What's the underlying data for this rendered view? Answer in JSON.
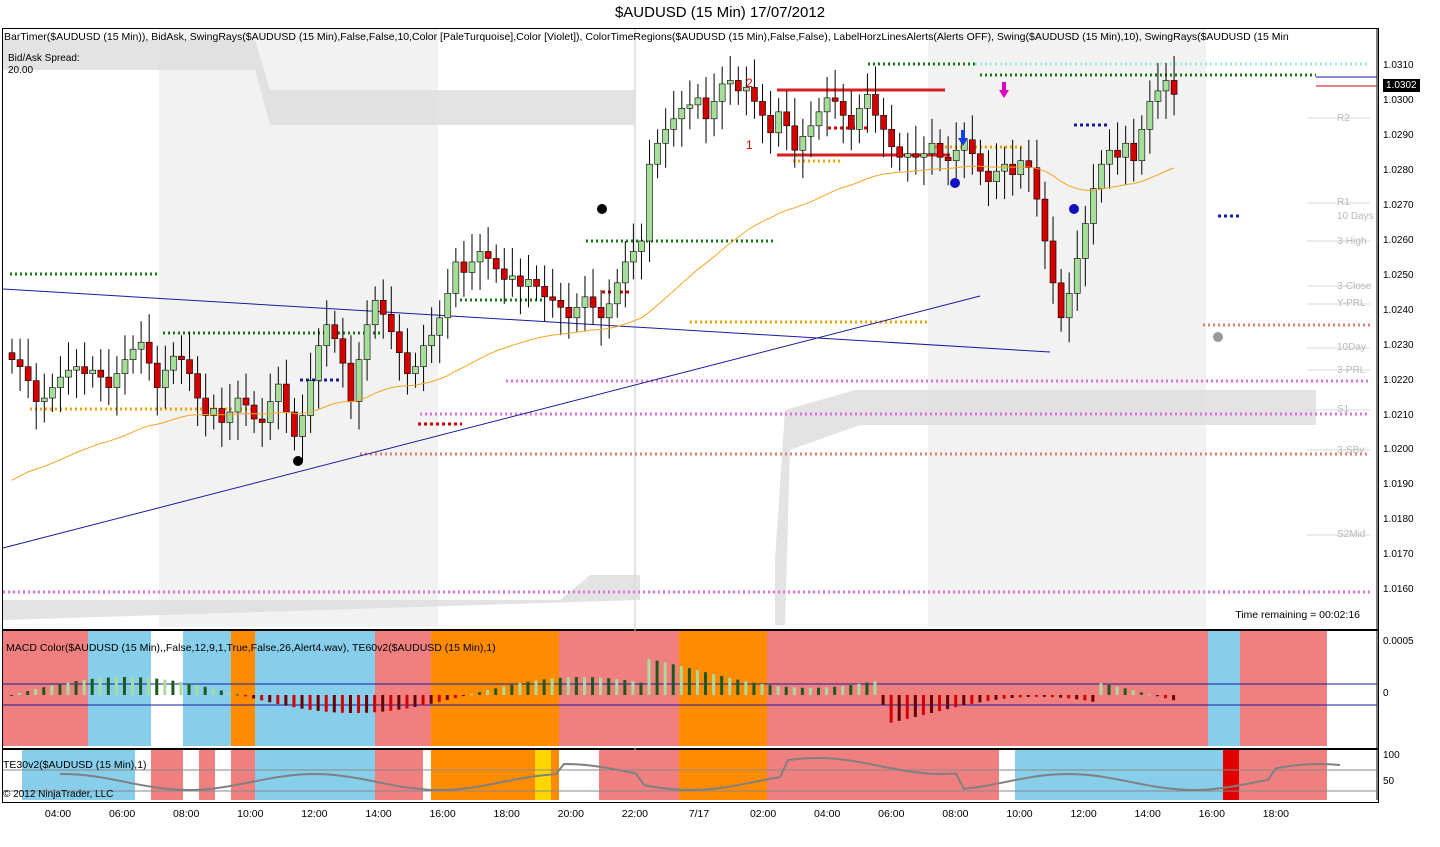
{
  "title": "$AUDUSD (15 Min)  17/07/2012",
  "indicator_list": "BarTimer($AUDUSD (15 Min)), BidAsk, SwingRays($AUDUSD (15 Min),False,False,10,Color [PaleTurquoise],Color [Violet]), ColorTimeRegions($AUDUSD (15 Min),False,False), LabelHorzLinesAlerts(Alerts OFF), Swing($AUDUSD (15 Min),10), SwingRays($AUDUSD (15 Min",
  "spread_label": "Bid/Ask Spread:",
  "spread_value": "20.00",
  "time_remaining": "Time remaining = 00:02:16",
  "current_price": "1.0302",
  "macd_label": "MACD Color($AUDUSD (15 Min),,False,12,9,1,True,False,26,Alert4.wav), TE60v2($AUDUSD (15 Min),1)",
  "te30_label": "TE30v2($AUDUSD (15 Min),1)",
  "copyright": "© 2012 NinjaTrader, LLC",
  "annotations": [
    "2",
    "1"
  ],
  "level_labels": [
    "R2",
    "R1",
    "10 Days",
    "3-High",
    "3-Close",
    "Y-PRL",
    "10Day",
    "3-PRL",
    "S1",
    "3-SBv",
    "S2Mid"
  ],
  "colors": {
    "up": "#a7dd9b",
    "down": "#d40000",
    "ema": "#f5a623",
    "trend": "#1a1aa0",
    "swing_high": "#137a13",
    "swing_low": "#f0a000",
    "region": "#f2f2f2",
    "pink": "#f08080",
    "blue": "#87ceeb",
    "orange": "#ff8c00"
  },
  "chart_data": {
    "type": "candlestick",
    "title": "$AUDUSD (15 Min)  17/07/2012",
    "x_ticks": [
      "04:00",
      "06:00",
      "08:00",
      "10:00",
      "12:00",
      "14:00",
      "16:00",
      "18:00",
      "20:00",
      "22:00",
      "7/17",
      "02:00",
      "04:00",
      "06:00",
      "08:00",
      "10:00",
      "12:00",
      "14:00",
      "16:00",
      "18:00"
    ],
    "y_ticks": [
      "1.0310",
      "1.0300",
      "1.0290",
      "1.0280",
      "1.0270",
      "1.0260",
      "1.0250",
      "1.0240",
      "1.0230",
      "1.0220",
      "1.0210",
      "1.0200",
      "1.0190",
      "1.0180",
      "1.0170",
      "1.0160"
    ],
    "ylim": [
      1.0156,
      1.0313
    ],
    "closes": [
      1.0226,
      1.0224,
      1.022,
      1.0214,
      1.0215,
      1.0218,
      1.0221,
      1.0223,
      1.0224,
      1.0222,
      1.0223,
      1.0221,
      1.0218,
      1.0222,
      1.0226,
      1.0229,
      1.0231,
      1.0225,
      1.0218,
      1.0223,
      1.0227,
      1.0226,
      1.0222,
      1.0215,
      1.021,
      1.0212,
      1.0208,
      1.0211,
      1.0215,
      1.0213,
      1.0209,
      1.0208,
      1.0214,
      1.0219,
      1.0211,
      1.0204,
      1.021,
      1.022,
      1.023,
      1.0236,
      1.0232,
      1.0225,
      1.0214,
      1.0226,
      1.0236,
      1.0243,
      1.0239,
      1.0234,
      1.0228,
      1.0222,
      1.0224,
      1.023,
      1.0233,
      1.0238,
      1.0245,
      1.0254,
      1.0251,
      1.0254,
      1.0257,
      1.0255,
      1.0252,
      1.0249,
      1.025,
      1.0247,
      1.0249,
      1.0247,
      1.0244,
      1.0243,
      1.0241,
      1.0238,
      1.0241,
      1.0244,
      1.0241,
      1.0238,
      1.0242,
      1.0248,
      1.0254,
      1.0257,
      1.026,
      1.0282,
      1.0288,
      1.0292,
      1.0295,
      1.0298,
      1.0299,
      1.0301,
      1.0295,
      1.03,
      1.0305,
      1.0306,
      1.0303,
      1.0304,
      1.03,
      1.0296,
      1.0291,
      1.0297,
      1.0293,
      1.0286,
      1.029,
      1.0293,
      1.0297,
      1.0301,
      1.03,
      1.0296,
      1.0292,
      1.0298,
      1.0302,
      1.0296,
      1.0292,
      1.0287,
      1.0284,
      1.0285,
      1.0284,
      1.0285,
      1.0288,
      1.0284,
      1.0283,
      1.0286,
      1.0289,
      1.0285,
      1.028,
      1.0277,
      1.028,
      1.0282,
      1.0279,
      1.0283,
      1.0281,
      1.0272,
      1.026,
      1.0248,
      1.0238,
      1.0245,
      1.0255,
      1.0265,
      1.0275,
      1.0282,
      1.0286,
      1.0284,
      1.0288,
      1.0283,
      1.0292,
      1.03,
      1.0303,
      1.0306,
      1.0302
    ]
  }
}
